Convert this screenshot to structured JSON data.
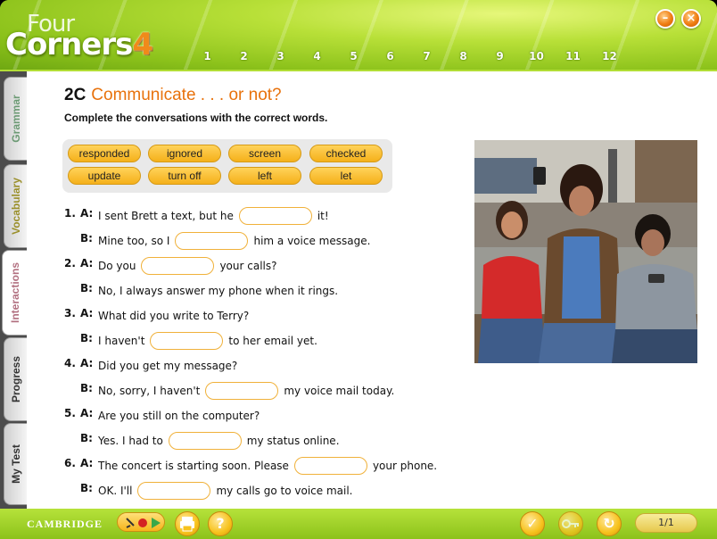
{
  "header": {
    "logo_four": "Four",
    "logo_corners": "Corners",
    "logo_level": "4",
    "units": [
      "1",
      "2",
      "3",
      "4",
      "5",
      "6",
      "7",
      "8",
      "9",
      "10",
      "11",
      "12"
    ],
    "minimize_glyph": "–",
    "close_glyph": "×"
  },
  "tabs": {
    "grammar": "Grammar",
    "vocabulary": "Vocabulary",
    "interactions": "Interactions",
    "progress": "Progress",
    "mytest": "My Test"
  },
  "exercise": {
    "code": "2C",
    "title": "Communicate . . . or not?",
    "instruction": "Complete the conversations with the correct words.",
    "word_bank": [
      "responded",
      "ignored",
      "screen",
      "checked",
      "update",
      "turn off",
      "left",
      "let"
    ],
    "items": [
      {
        "num": "1.",
        "a_before": "I sent Brett a text, but he",
        "a_after": "it!",
        "b_before": "Mine too, so I",
        "b_after": "him a voice message."
      },
      {
        "num": "2.",
        "a_before": "Do you",
        "a_after": "your calls?",
        "b_before": "No, I always answer my phone when it rings.",
        "b_after": ""
      },
      {
        "num": "3.",
        "a_before": "What did you write to Terry?",
        "a_after": "",
        "b_before": "I haven't",
        "b_after": "to her email yet."
      },
      {
        "num": "4.",
        "a_before": "Did you get my message?",
        "a_after": "",
        "b_before": "No, sorry, I haven't",
        "b_after": "my voice mail today."
      },
      {
        "num": "5.",
        "a_before": "Are you still on the computer?",
        "a_after": "",
        "b_before": "Yes. I had to",
        "b_after": "my status online."
      },
      {
        "num": "6.",
        "a_before": "The concert is starting soon. Please",
        "a_after": "your phone.",
        "b_before": "OK. I'll",
        "b_after": "my calls go to voice mail."
      }
    ],
    "speaker_a": "A:",
    "speaker_b": "B:"
  },
  "footer": {
    "brand": "CAMBRIDGE",
    "print_icon": "print-icon",
    "help_glyph": "?",
    "check_glyph": "✓",
    "reset_glyph": "↻",
    "page": "1/1"
  }
}
